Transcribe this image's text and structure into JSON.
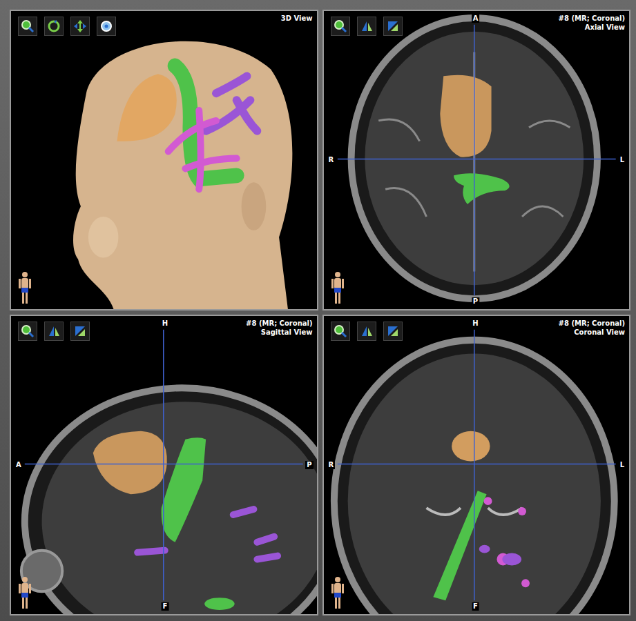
{
  "panels": [
    {
      "kind": "3d",
      "title": "3D View"
    },
    {
      "kind": "axial",
      "series": "#8 (MR; Coronal)",
      "title": "Axial View",
      "axes": {
        "top": "A",
        "bottom": "P",
        "left": "R",
        "right": "L"
      }
    },
    {
      "kind": "sagittal",
      "series": "#8 (MR; Coronal)",
      "title": "Sagittal View",
      "axes": {
        "top": "H",
        "bottom": "F",
        "left": "A",
        "right": "P"
      }
    },
    {
      "kind": "coronal",
      "series": "#8 (MR; Coronal)",
      "title": "Coronal View",
      "axes": {
        "top": "H",
        "bottom": "F",
        "left": "R",
        "right": "L"
      }
    }
  ],
  "structures": [
    {
      "color": "#e2a763"
    },
    {
      "color": "#4fc24a"
    },
    {
      "color": "#9a55d6"
    },
    {
      "color": "#d25ad2"
    }
  ]
}
